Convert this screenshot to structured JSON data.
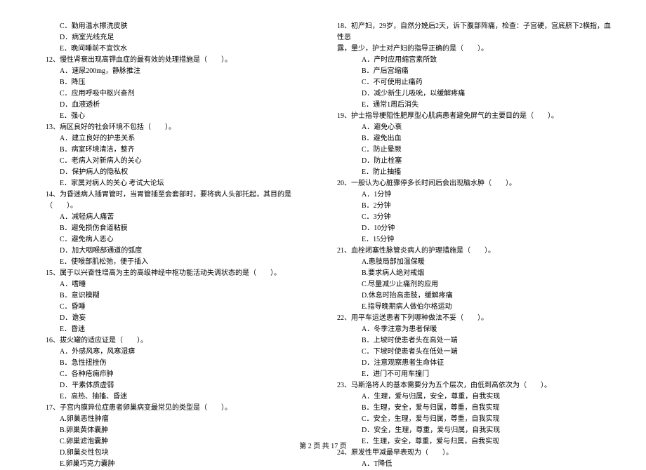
{
  "left": {
    "pre_opts": [
      "C．勤用温水擦洗皮肤",
      "D．病室光线充足",
      "E．晚间睡前不宜饮水"
    ],
    "q12": {
      "text": "12、慢性肾衰出现高钾血症的最有效的处理措施是（　　）。",
      "opts": [
        "A．速尿200mg，静脉推注",
        "B．降压",
        "C．应用呼吸中枢兴奋剂",
        "D．血液透析",
        "E．强心"
      ]
    },
    "q13": {
      "text": "13、病区良好的社会环境不包括（　　）。",
      "opts": [
        "A．建立良好的护患关系",
        "B．病室环境清洁，整齐",
        "C．老病人对新病人的关心",
        "D．保护病人的隐私权",
        "E．家属对病人的关心 考试大论坛"
      ]
    },
    "q14": {
      "text": "14、为昏迷病人插胃管时，当胃管插至会套部时，要将病人头部托起，其目的是（　　）。",
      "opts": [
        "A．减轻病人痛苦",
        "B．避免损伤食道粘膜",
        "C．避免病人恶心",
        "D．加大咽喉部通道的弧度",
        "E．使喉部肌松弛，便于插入"
      ]
    },
    "q15": {
      "text": "15、属于以兴奋性增高为主的高级神经中枢功能活动失调状态的是（　　）。",
      "opts": [
        "A．嗜睡",
        "B．意识模糊",
        "C．昏睡",
        "D．谵妄",
        "E．昏迷"
      ]
    },
    "q16": {
      "text": "16、拔火罐的适应证是（　　）。",
      "opts": [
        "A．外感风寒，风寒湿痹",
        "B．急性扭挫伤",
        "C．各种疮痈疖肿",
        "D．平素体质虚弱",
        "E．高热、抽搐、昏迷"
      ]
    },
    "q17": {
      "text": "17、子宫内膜异位症患者卵巢病变最常见的类型是（　　）。",
      "opts": [
        "A.卵巢恶性肿瘤",
        "B.卵巢黄体囊肿",
        "C.卵巢滤泡囊肿",
        "D.卵巢炎性包块",
        "E.卵巢巧克力囊肿"
      ]
    }
  },
  "right": {
    "q18": {
      "line1": "18、初产妇，29岁，自然分娩后2天，诉下腹部阵痛，检查：子宫硬，宫底脐下2横指，血性恶",
      "line2": "露，量少，护士对产妇的指导正确的是（　　）。",
      "opts": [
        "A．产时应用缩宫素所致",
        "B．产后宫缩痛",
        "C．不可使用止痛药",
        "D．减少新生儿吸吮，以缓解疼痛",
        "E．通常1周后消失"
      ]
    },
    "q19": {
      "text": "19、护士指导梗阻性肥厚型心肌病患者避免屏气的主要目的是（　　）。",
      "opts": [
        "A．避免心衰",
        "B．避免出血",
        "C．防止晕厥",
        "D．防止栓塞",
        "E．防止抽搐"
      ]
    },
    "q20": {
      "text": "20、一般认为心脏骤停多长时间后会出现脑水肿（　　）。",
      "opts": [
        "A．1分钟",
        "B．2分钟",
        "C．3分钟",
        "D．10分钟",
        "E．15分钟"
      ]
    },
    "q21": {
      "text": "21、血栓闭塞性脉管炎病人的护理措施是（　　）。",
      "opts": [
        "A.患肢局部加温保暖",
        "B.要求病人绝对戒烟",
        "C.尽量减少止痛剂的应用",
        "D.休息时抬高患肢，缓解疼痛",
        "E.指导晚期病人做伯尔格运动"
      ]
    },
    "q22": {
      "text": "22、用平车运送患者下列哪种做法不妥（　　）。",
      "opts": [
        "A．冬季注意为患者保暖",
        "B．上坡时使患者头在高处一端",
        "C．下坡时使患者头在低处一端",
        "D．注意观察患者生命体征",
        "E．进门不可用车撞门"
      ]
    },
    "q23": {
      "text": "23、马斯洛将人的基本需要分为五个层次，由低到高依次为（　　）。",
      "opts": [
        "A．生理，爱与归属，安全，尊重，自我实现",
        "B．生理，安全，爱与归属，尊重，自我实现",
        "C．安全，生理，爱与归属，尊重，自我实现",
        "D．安全，生理，尊重，爱与归属，自我实现",
        "E．生理，安全，尊重，爱与归属，自我实现"
      ]
    },
    "q24": {
      "text": "24、原发性甲减最早表现为（　　）。",
      "opts": [
        "A．T降低"
      ]
    }
  },
  "footer": "第 2 页 共 17 页"
}
